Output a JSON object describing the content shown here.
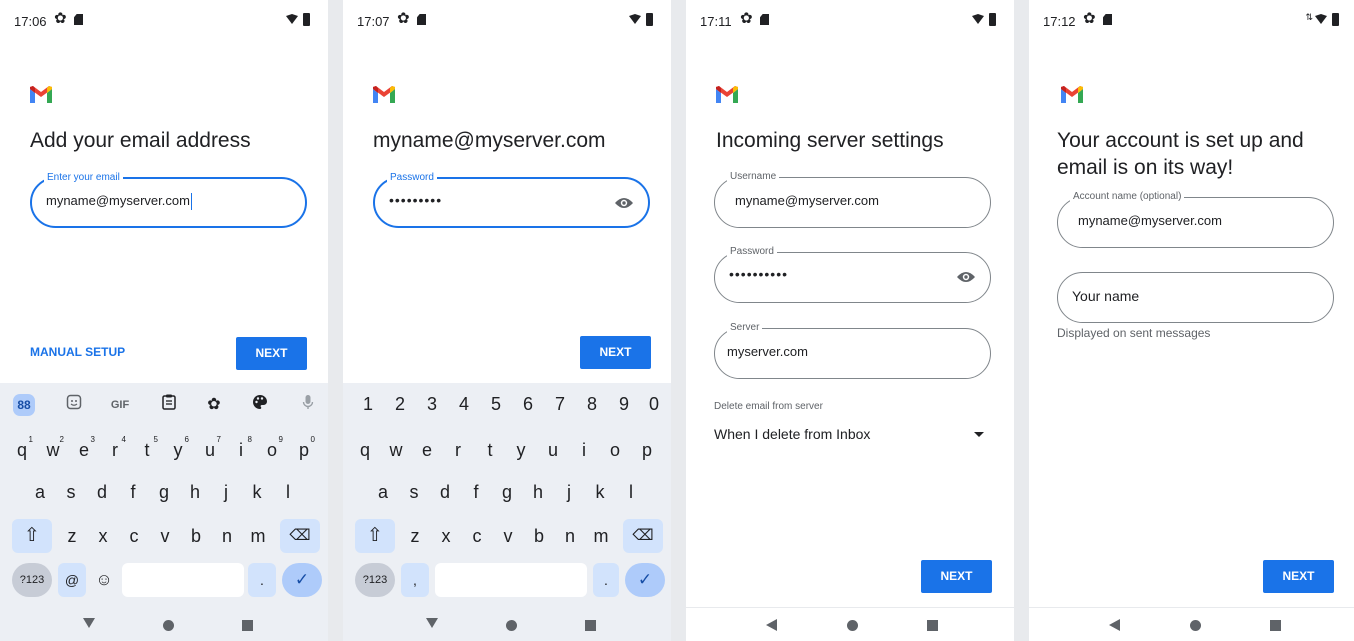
{
  "colors": {
    "accent": "#1a73e8",
    "gmail_red": "#ea4335",
    "gmail_blue": "#4285f4",
    "gmail_green": "#34a853",
    "gmail_yellow": "#fbbc04"
  },
  "screen1": {
    "time": "17:06",
    "title": "Add your email address",
    "email_label": "Enter your email",
    "email_value": "myname@myserver.com",
    "manual_setup": "MANUAL SETUP",
    "next": "NEXT",
    "kb_toolbar": [
      "88",
      "sticker-icon",
      "GIF",
      "clipboard-icon",
      "gear-icon",
      "palette-icon",
      "mic-icon"
    ],
    "row1": [
      "q",
      "w",
      "e",
      "r",
      "t",
      "y",
      "u",
      "i",
      "o",
      "p"
    ],
    "row1_hints": [
      "1",
      "2",
      "3",
      "4",
      "5",
      "6",
      "7",
      "8",
      "9",
      "0"
    ],
    "row2": [
      "a",
      "s",
      "d",
      "f",
      "g",
      "h",
      "j",
      "k",
      "l"
    ],
    "row3": [
      "z",
      "x",
      "c",
      "v",
      "b",
      "n",
      "m"
    ],
    "sym_key": "?123",
    "at_key": "@",
    "period_key": "."
  },
  "screen2": {
    "time": "17:07",
    "title": "myname@myserver.com",
    "password_label": "Password",
    "password_value": "•••••••••",
    "next": "NEXT",
    "numbers": [
      "1",
      "2",
      "3",
      "4",
      "5",
      "6",
      "7",
      "8",
      "9",
      "0"
    ],
    "row1": [
      "q",
      "w",
      "e",
      "r",
      "t",
      "y",
      "u",
      "i",
      "o",
      "p"
    ],
    "row2": [
      "a",
      "s",
      "d",
      "f",
      "g",
      "h",
      "j",
      "k",
      "l"
    ],
    "row3": [
      "z",
      "x",
      "c",
      "v",
      "b",
      "n",
      "m"
    ],
    "sym_key": "?123",
    "comma_key": ",",
    "period_key": "."
  },
  "screen3": {
    "time": "17:11",
    "title": "Incoming server settings",
    "username_label": "Username",
    "username_value": "myname@myserver.com",
    "password_label": "Password",
    "password_value": "••••••••••",
    "server_label": "Server",
    "server_value": "myserver.com",
    "delete_label": "Delete email from server",
    "delete_value": "When I delete from Inbox",
    "next": "NEXT"
  },
  "screen4": {
    "time": "17:12",
    "title_line1": "Your account is set up and",
    "title_line2": "email is on its way!",
    "account_label": "Account name (optional)",
    "account_value": "myname@myserver.com",
    "name_placeholder": "Your name",
    "helper": "Displayed on sent messages",
    "next": "NEXT"
  }
}
